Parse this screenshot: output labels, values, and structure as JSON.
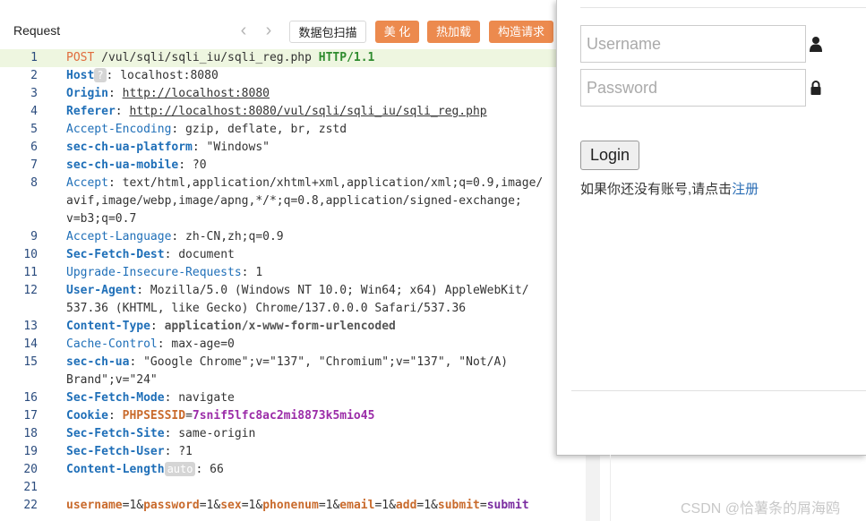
{
  "request_panel": {
    "title": "Request",
    "buttons": {
      "scan": "数据包扫描",
      "beautify": "美 化",
      "hotload": "热加载",
      "build": "构造请求"
    }
  },
  "code": {
    "lines": [
      {
        "num": "1",
        "segs": [
          {
            "t": "POST",
            "c": "k-method"
          },
          {
            "t": " /vul/sqli/sqli_iu/sqli_reg.php ",
            "c": ""
          },
          {
            "t": "HTTP/1.1",
            "c": "k-proto"
          }
        ]
      },
      {
        "num": "2",
        "segs": [
          {
            "t": "Host",
            "c": "k-bold"
          },
          {
            "t": "?",
            "c": "badge"
          },
          {
            "t": ": localhost:8080",
            "c": ""
          }
        ]
      },
      {
        "num": "3",
        "segs": [
          {
            "t": "Origin",
            "c": "k-bold"
          },
          {
            "t": ": ",
            "c": ""
          },
          {
            "t": "http://localhost:8080",
            "c": "k-url"
          }
        ]
      },
      {
        "num": "4",
        "segs": [
          {
            "t": "Referer",
            "c": "k-bold"
          },
          {
            "t": ": ",
            "c": ""
          },
          {
            "t": "http://localhost:8080/vul/sqli/sqli_iu/sqli_reg.php",
            "c": "k-url"
          }
        ]
      },
      {
        "num": "5",
        "segs": [
          {
            "t": "Accept-Encoding",
            "c": "k-blue"
          },
          {
            "t": ": gzip, deflate, br, zstd",
            "c": ""
          }
        ]
      },
      {
        "num": "6",
        "segs": [
          {
            "t": "sec-ch-ua-platform",
            "c": "k-bold"
          },
          {
            "t": ": \"Windows\"",
            "c": ""
          }
        ]
      },
      {
        "num": "7",
        "segs": [
          {
            "t": "sec-ch-ua-mobile",
            "c": "k-bold"
          },
          {
            "t": ": ?0",
            "c": ""
          }
        ]
      },
      {
        "num": "8",
        "segs": [
          {
            "t": "Accept",
            "c": "k-blue"
          },
          {
            "t": ": text/html,application/xhtml+xml,application/xml;q=0.9,image/",
            "c": ""
          }
        ]
      },
      {
        "num": "",
        "segs": [
          {
            "t": "avif,image/webp,image/apng,*/*;q=0.8,application/signed-exchange;",
            "c": ""
          }
        ]
      },
      {
        "num": "",
        "segs": [
          {
            "t": "v=b3;q=0.7",
            "c": ""
          }
        ]
      },
      {
        "num": "9",
        "segs": [
          {
            "t": "Accept-Language",
            "c": "k-blue"
          },
          {
            "t": ": zh-CN,zh;q=0.9",
            "c": ""
          }
        ]
      },
      {
        "num": "10",
        "segs": [
          {
            "t": "Sec-Fetch-Dest",
            "c": "k-bold"
          },
          {
            "t": ": document",
            "c": ""
          }
        ]
      },
      {
        "num": "11",
        "segs": [
          {
            "t": "Upgrade-Insecure-Requests",
            "c": "k-blue"
          },
          {
            "t": ": 1",
            "c": ""
          }
        ]
      },
      {
        "num": "12",
        "segs": [
          {
            "t": "User-Agent",
            "c": "k-bold"
          },
          {
            "t": ": Mozilla/5.0 (Windows NT 10.0; Win64; x64) AppleWebKit/",
            "c": ""
          }
        ]
      },
      {
        "num": "",
        "segs": [
          {
            "t": "537.36 (KHTML, like Gecko) Chrome/137.0.0.0 Safari/537.36",
            "c": ""
          }
        ]
      },
      {
        "num": "13",
        "segs": [
          {
            "t": "Content-Type",
            "c": "k-bold"
          },
          {
            "t": ": ",
            "c": ""
          },
          {
            "t": "application/x-www-form-urlencoded",
            "c": "k-vbold"
          }
        ]
      },
      {
        "num": "14",
        "segs": [
          {
            "t": "Cache-Control",
            "c": "k-blue"
          },
          {
            "t": ": max-age=0",
            "c": ""
          }
        ]
      },
      {
        "num": "15",
        "segs": [
          {
            "t": "sec-ch-ua",
            "c": "k-bold"
          },
          {
            "t": ": \"Google Chrome\";v=\"137\", \"Chromium\";v=\"137\", \"Not/A)",
            "c": ""
          }
        ]
      },
      {
        "num": "",
        "segs": [
          {
            "t": "Brand\";v=\"24\"",
            "c": ""
          }
        ]
      },
      {
        "num": "16",
        "segs": [
          {
            "t": "Sec-Fetch-Mode",
            "c": "k-bold"
          },
          {
            "t": ": navigate",
            "c": ""
          }
        ]
      },
      {
        "num": "17",
        "segs": [
          {
            "t": "Cookie",
            "c": "k-bold"
          },
          {
            "t": ": ",
            "c": ""
          },
          {
            "t": "PHPSESSID",
            "c": "k-orange"
          },
          {
            "t": "=",
            "c": ""
          },
          {
            "t": "7snif5lfc8ac2mi8873k5mio45",
            "c": "k-purple"
          }
        ]
      },
      {
        "num": "18",
        "segs": [
          {
            "t": "Sec-Fetch-Site",
            "c": "k-bold"
          },
          {
            "t": ": same-origin",
            "c": ""
          }
        ]
      },
      {
        "num": "19",
        "segs": [
          {
            "t": "Sec-Fetch-User",
            "c": "k-bold"
          },
          {
            "t": ": ?1",
            "c": ""
          }
        ]
      },
      {
        "num": "20",
        "segs": [
          {
            "t": "Content-Length",
            "c": "k-bold"
          },
          {
            "t": "auto",
            "c": "badge"
          },
          {
            "t": ": 66",
            "c": ""
          }
        ]
      },
      {
        "num": "21",
        "segs": []
      },
      {
        "num": "22",
        "segs": [
          {
            "t": "username",
            "c": "k-pname"
          },
          {
            "t": "=1&",
            "c": ""
          },
          {
            "t": "password",
            "c": "k-pname"
          },
          {
            "t": "=1&",
            "c": ""
          },
          {
            "t": "sex",
            "c": "k-pname"
          },
          {
            "t": "=1&",
            "c": ""
          },
          {
            "t": "phonenum",
            "c": "k-pname"
          },
          {
            "t": "=1&",
            "c": ""
          },
          {
            "t": "email",
            "c": "k-pname"
          },
          {
            "t": "=1&",
            "c": ""
          },
          {
            "t": "add",
            "c": "k-pname"
          },
          {
            "t": "=1&",
            "c": ""
          },
          {
            "t": "submit",
            "c": "k-pname"
          },
          {
            "t": "=",
            "c": ""
          },
          {
            "t": "submit",
            "c": "k-pval"
          }
        ]
      }
    ]
  },
  "login_form": {
    "username_placeholder": "Username",
    "password_placeholder": "Password",
    "user_icon": "user-icon",
    "lock_icon": "lock-icon",
    "login_label": "Login",
    "register_prompt": "如果你还没有账号,请点击",
    "register_link": "注册"
  },
  "watermark": "CSDN @恰薯条的屑海鸥"
}
